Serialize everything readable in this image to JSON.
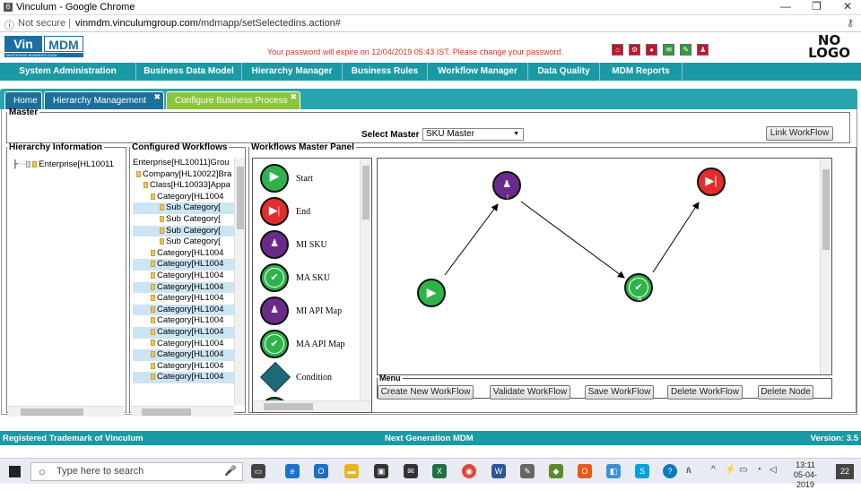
{
  "browser": {
    "title": "Vinculum - Google Chrome",
    "security": "Not secure",
    "url_host": "vinmdm.vinculumgroup.com",
    "url_path": "/mdmapp/setSelectedins.action#"
  },
  "header": {
    "logo_vin": "Vin",
    "logo_mdm": "MDM",
    "logo_tagline": "MASTERING BUSINESS DATA",
    "password_message": "Your password will expire on 12/04/2019 05:43 IST. Please change your password.",
    "nologo_line1": "NO",
    "nologo_line2": "LOGO"
  },
  "menu": [
    "System Administration",
    "Business Data Model",
    "Hierarchy Manager",
    "Business Rules",
    "Workflow Manager",
    "Data Quality",
    "MDM Reports"
  ],
  "tabs": [
    {
      "label": "Home"
    },
    {
      "label": "Hierarchy Management"
    },
    {
      "label": "Configure Business Process"
    }
  ],
  "master": {
    "legend": "Master",
    "select_label": "Select Master",
    "selected": "SKU Master",
    "link_button": "Link WorkFlow"
  },
  "hierarchy": {
    "legend": "Hierarchy Information",
    "root": "Enterprise[HL10011"
  },
  "configured": {
    "legend": "Configured Workflows",
    "items": [
      "Enterprise[HL10011]Grou",
      "Company[HL10022]Bra",
      "Class[HL10033]Appa",
      "Category[HL1004",
      "Sub Category[",
      "Sub Category[",
      "Sub Category[",
      "Sub Category[",
      "Category[HL1004",
      "Category[HL1004",
      "Category[HL1004",
      "Category[HL1004",
      "Category[HL1004",
      "Category[HL1004",
      "Category[HL1004",
      "Category[HL1004",
      "Category[HL1004",
      "Category[HL1004",
      "Category[HL1004",
      "Category[HL1004"
    ]
  },
  "panel": {
    "legend": "Workflows Master Panel",
    "items": [
      "Start",
      "End",
      "MI SKU",
      "MA SKU",
      "MI API Map",
      "MA API Map",
      "Condition"
    ]
  },
  "canvas_nodes": {
    "mi": "I",
    "ma": "A"
  },
  "menu_box": {
    "legend": "Menu",
    "buttons": [
      "Create New WorkFlow",
      "Validate WorkFlow",
      "Save WorkFlow",
      "Delete WorkFlow",
      "Delete Node"
    ]
  },
  "footer": {
    "left": "Registered Trademark of Vinculum",
    "center": "Next Generation MDM",
    "version": "Version: 3.5"
  },
  "taskbar": {
    "search": "Type here to search",
    "time": "13:11",
    "date": "05-04-2019",
    "badge": "22"
  }
}
